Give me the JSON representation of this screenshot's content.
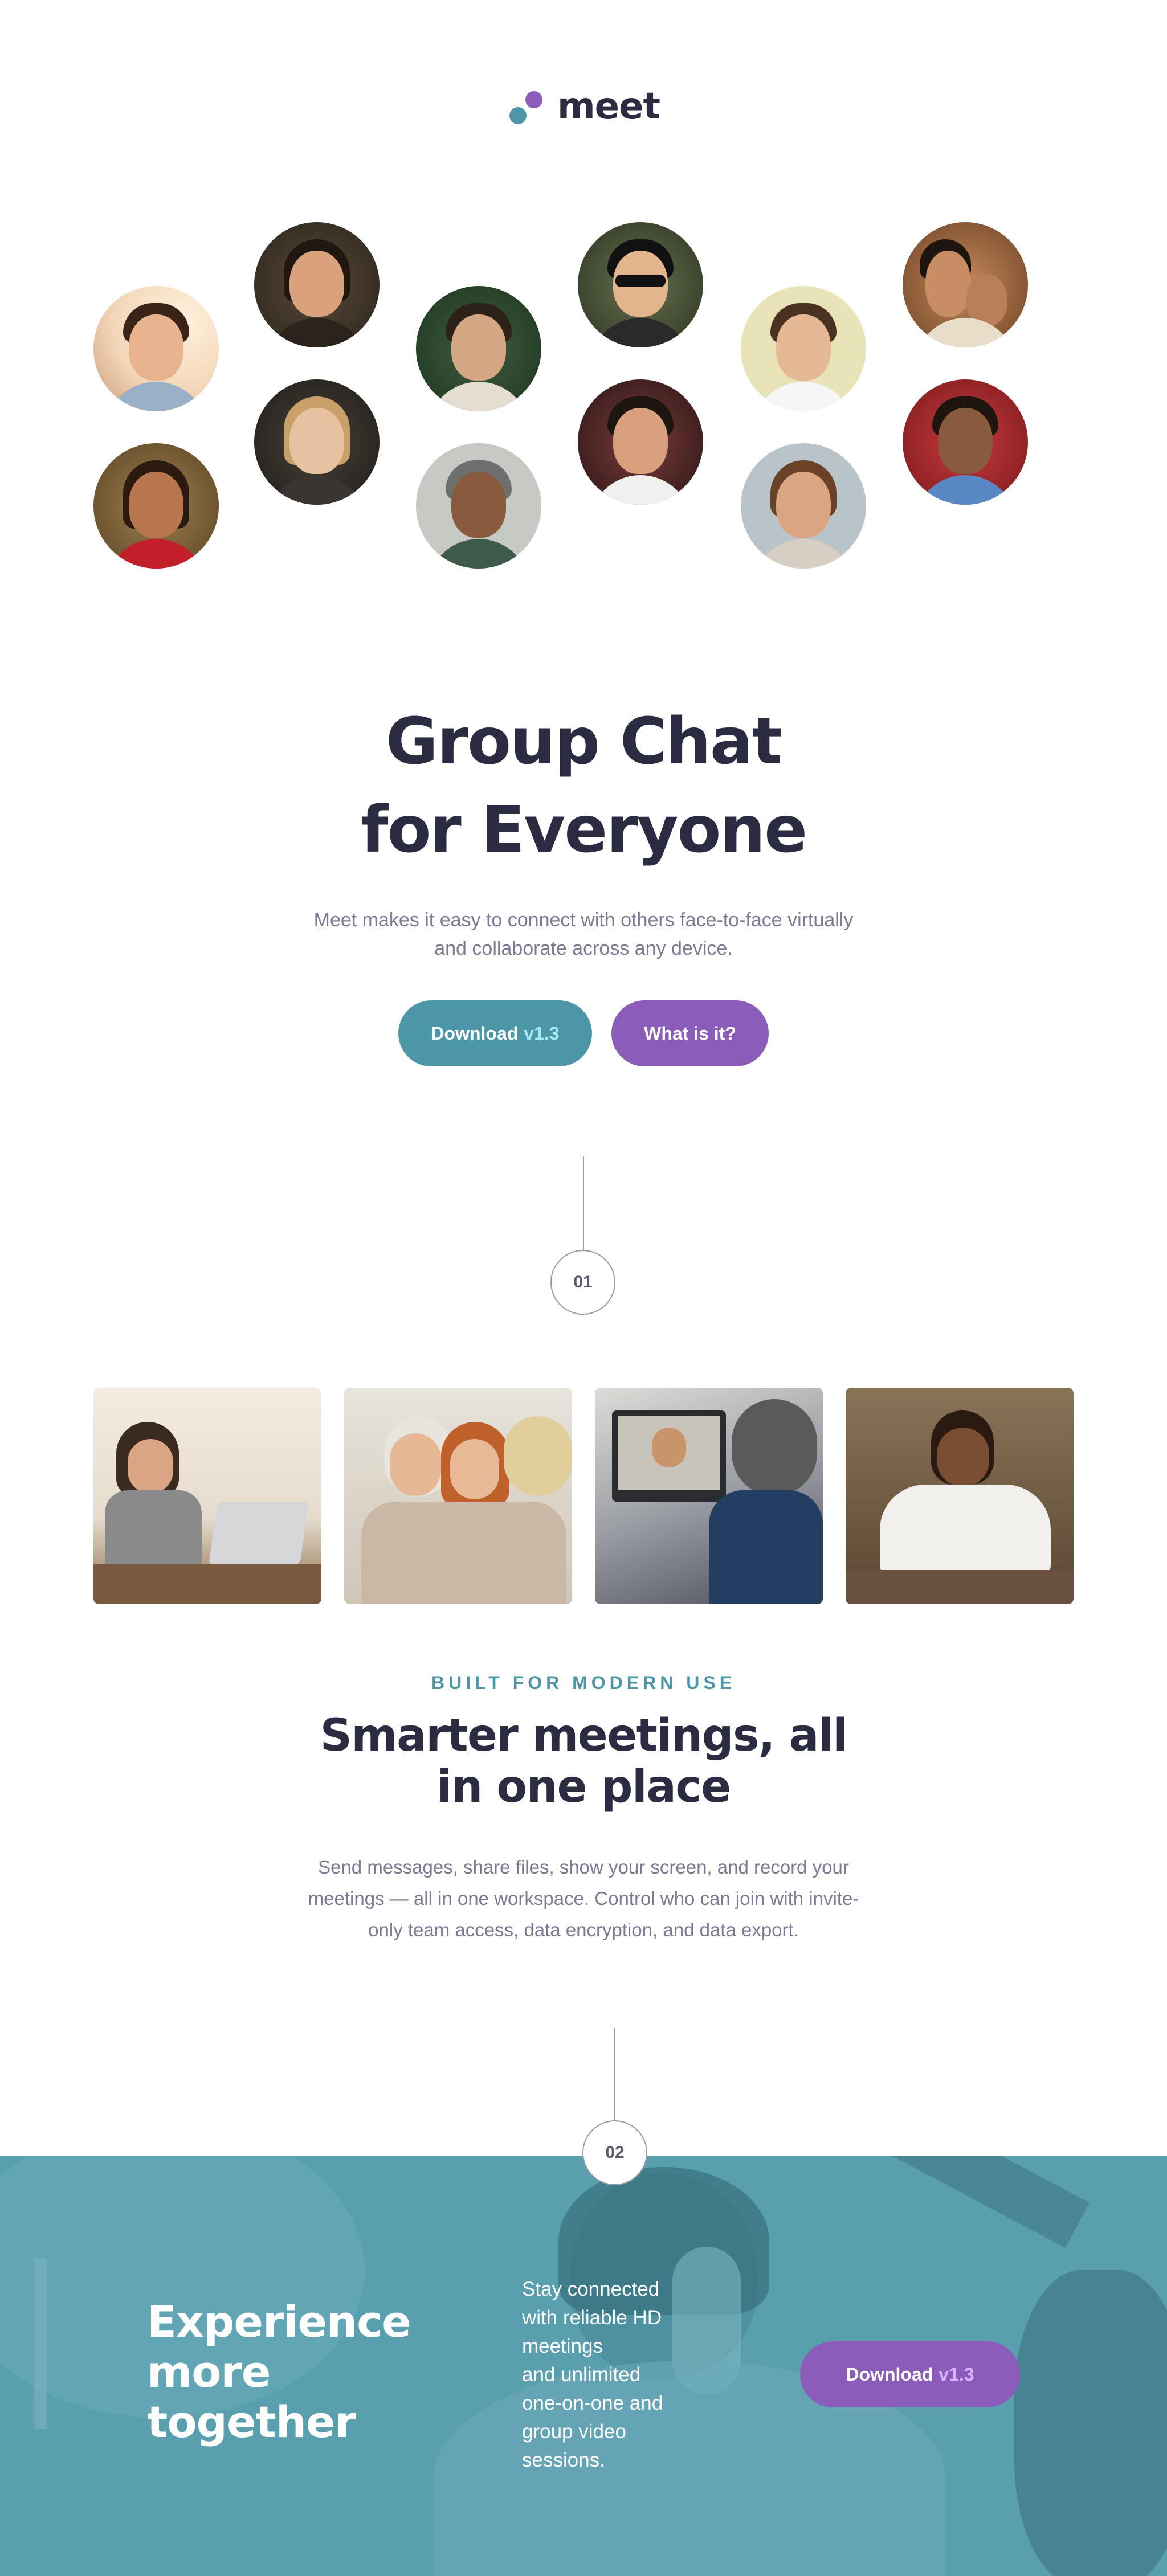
{
  "brand": {
    "name": "meet",
    "logo_colors": [
      "#4d96a8",
      "#8b5cb9"
    ]
  },
  "avatars": [
    {
      "name": "avatar-1",
      "bg": "#f3d6b8",
      "skin": "#e8b48f",
      "hair": "#3a2418",
      "shirt": "#9ab0c6"
    },
    {
      "name": "avatar-2",
      "bg": "#3b3227",
      "skin": "#d9a27d",
      "hair": "#1f1710",
      "shirt": "#2a241d"
    },
    {
      "name": "avatar-3",
      "bg": "#2e4a32",
      "skin": "#d5a683",
      "hair": "#2c2219",
      "shirt": "#e6ddd2"
    },
    {
      "name": "avatar-4",
      "bg": "#47533a",
      "skin": "#e3b58d",
      "hair": "#111111",
      "shirt": "#2a2a2a"
    },
    {
      "name": "avatar-5",
      "bg": "#e9e4b8",
      "skin": "#e5b896",
      "hair": "#4a3222",
      "shirt": "#f6f6f6"
    },
    {
      "name": "avatar-6",
      "bg": "#8b5a3c",
      "skin": "#c88d64",
      "hair": "#1d1510",
      "shirt": "#e8ddc8"
    },
    {
      "name": "avatar-7",
      "bg": "#8c6a3c",
      "skin": "#b8764c",
      "hair": "#2a1a10",
      "shirt": "#c21f2a"
    },
    {
      "name": "avatar-8",
      "bg": "#2d2a26",
      "skin": "#e6c2a0",
      "hair": "#c9a06a",
      "shirt": "#3a3530"
    },
    {
      "name": "avatar-9",
      "bg": "#c7c9c4",
      "skin": "#8a5a3c",
      "hair": "#6e6e6e",
      "shirt": "#3d5a4a"
    },
    {
      "name": "avatar-10",
      "bg": "#4a2a2a",
      "skin": "#d9a07e",
      "hair": "#1d1510",
      "shirt": "#f0f0f0"
    },
    {
      "name": "avatar-11",
      "bg": "#b8c4c8",
      "skin": "#d9a582",
      "hair": "#6a4228",
      "shirt": "#d8cfc4"
    },
    {
      "name": "avatar-12",
      "bg": "#b32c2f",
      "skin": "#8a5a3c",
      "hair": "#1d1510",
      "shirt": "#5a88c4"
    }
  ],
  "hero": {
    "title_line1": "Group Chat",
    "title_line2": "for Everyone",
    "subtitle": "Meet makes it easy to connect with others face-to-face virtually and collaborate across any device.",
    "download_label": "Download",
    "download_version": "v1.3",
    "whatis_label": "What is it?"
  },
  "steps": {
    "one": "01",
    "two": "02"
  },
  "photos": [
    {
      "name": "photo-woman-laptop",
      "bg": "#efe6dc",
      "accent": "#7a6a5a"
    },
    {
      "name": "photo-women-phone",
      "bg": "#d8d2c6",
      "accent": "#c98a6a"
    },
    {
      "name": "photo-video-call",
      "bg": "#6a7078",
      "accent": "#2b4a6e"
    },
    {
      "name": "photo-man-phone",
      "bg": "#6e5a44",
      "accent": "#f2f0ec"
    }
  ],
  "feature": {
    "eyebrow": "BUILT FOR MODERN USE",
    "title": "Smarter meetings, all in one place",
    "subtitle": "Send messages, share files, show your screen, and record your meetings — all in one workspace. Control who can join with invite-only team access, data encryption, and data export."
  },
  "band": {
    "title_line1": "Experience",
    "title_line2": "more",
    "title_line3": "together",
    "text_lines": [
      "Stay connected",
      "with reliable HD",
      "meetings",
      "and unlimited",
      "one-on-one and",
      "group video",
      "sessions."
    ],
    "download_label": "Download",
    "download_version": "v1.3",
    "overlay_color": "#5a9fae"
  }
}
